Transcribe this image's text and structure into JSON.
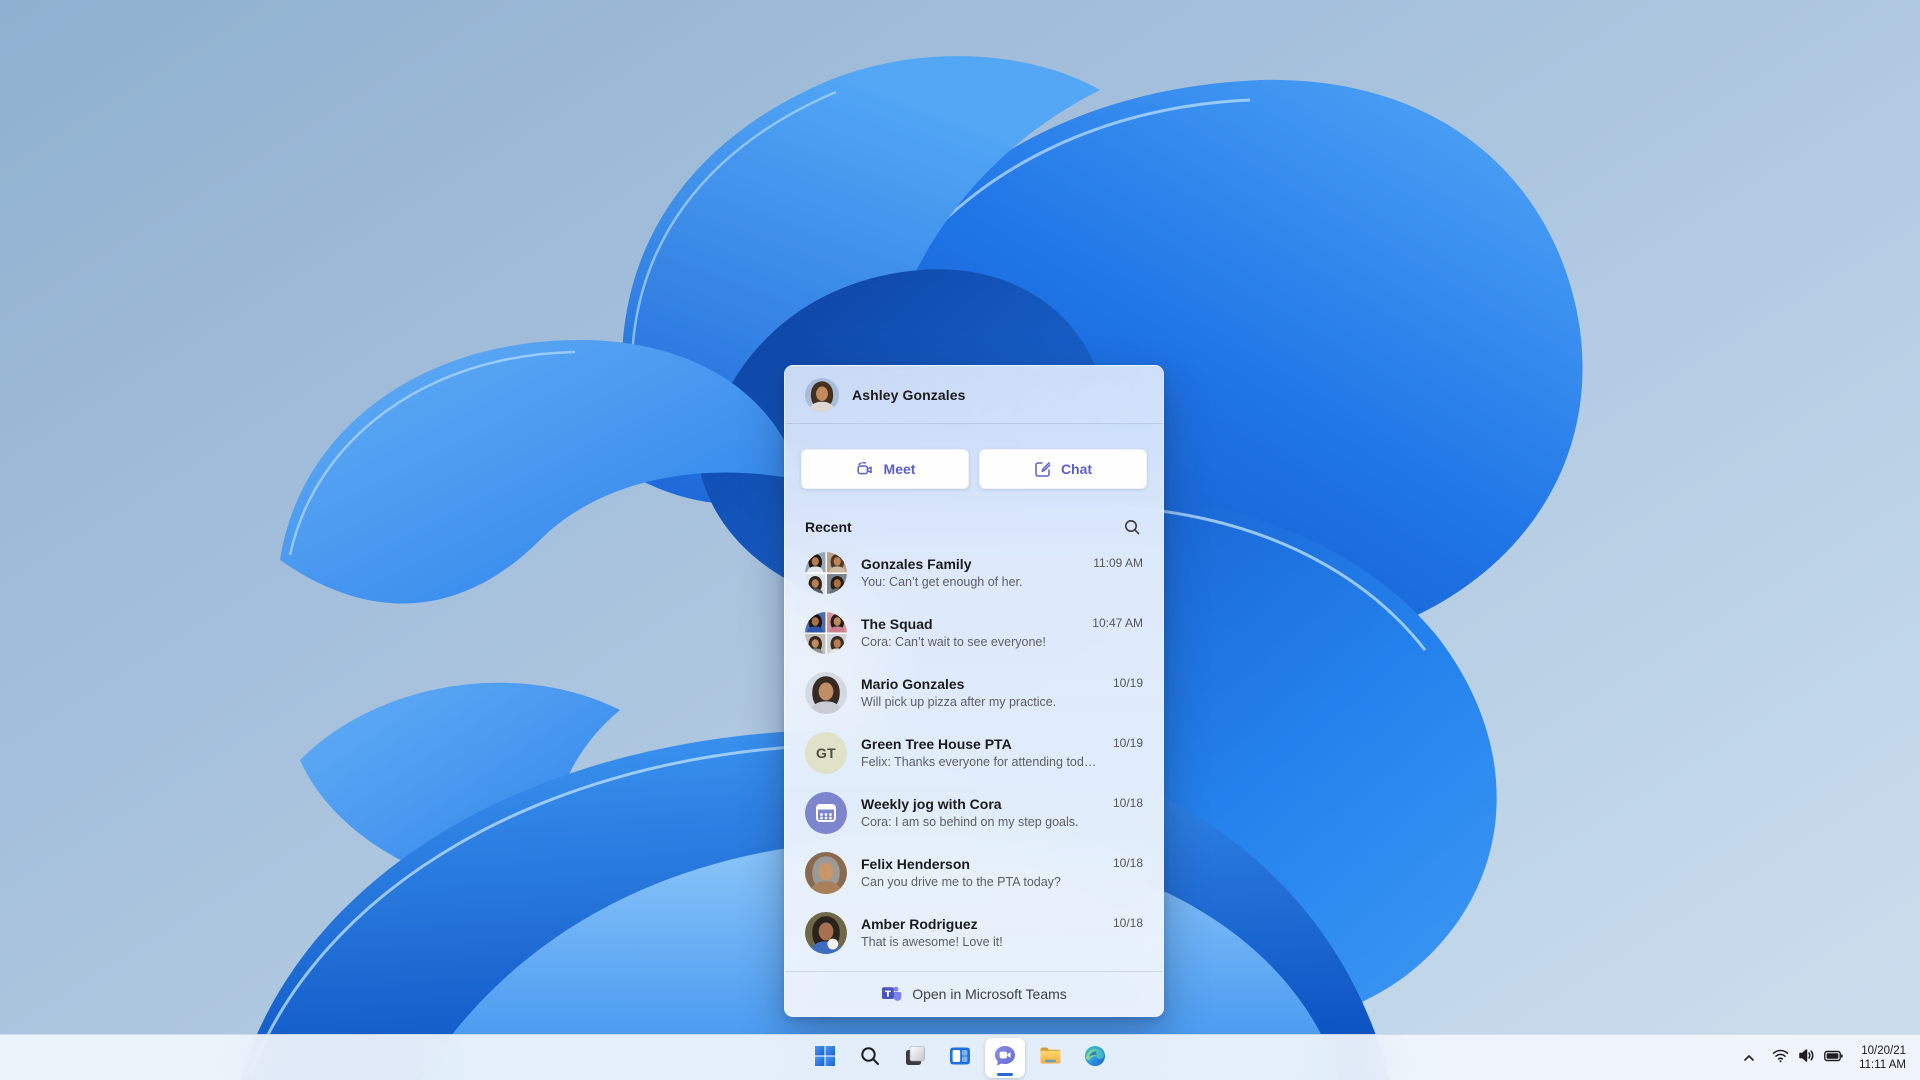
{
  "desktop": {
    "wallpaper_name": "windows-11-bloom-blue"
  },
  "chat_flyout": {
    "header": {
      "user_name": "Ashley Gonzales",
      "avatar": "ashley-photo-avatar"
    },
    "actions": [
      {
        "id": "meet",
        "label": "Meet",
        "icon": "video-camera-icon"
      },
      {
        "id": "chat",
        "label": "Chat",
        "icon": "compose-icon"
      }
    ],
    "recent": {
      "title": "Recent",
      "search_icon": "search-icon",
      "items": [
        {
          "name": "Gonzales Family",
          "preview": "You: Can’t get enough of her.",
          "time": "11:09 AM",
          "avatar_type": "group",
          "avatar_style": "family"
        },
        {
          "name": "The Squad",
          "preview": "Cora: Can’t wait to see everyone!",
          "time": "10:47 AM",
          "avatar_type": "group",
          "avatar_style": "squad"
        },
        {
          "name": "Mario Gonzales",
          "preview": "Will pick up pizza after my practice.",
          "time": "10/19",
          "avatar_type": "photo",
          "avatar_style": "mario"
        },
        {
          "name": "Green Tree House PTA",
          "preview": "Felix: Thanks everyone for attending today.",
          "time": "10/19",
          "avatar_type": "initials",
          "avatar_style": "initials",
          "initials": "GT"
        },
        {
          "name": "Weekly jog with Cora",
          "preview": "Cora: I am so behind on my step goals.",
          "time": "10/18",
          "avatar_type": "calendar",
          "avatar_style": "calendar"
        },
        {
          "name": "Felix Henderson",
          "preview": "Can you drive me to the PTA today?",
          "time": "10/18",
          "avatar_type": "photo",
          "avatar_style": "felix"
        },
        {
          "name": "Amber Rodriguez",
          "preview": "That is awesome! Love it!",
          "time": "10/18",
          "avatar_type": "photo",
          "avatar_style": "amber",
          "prop": true
        }
      ]
    },
    "footer": {
      "label": "Open in Microsoft Teams",
      "icon": "teams-logo-icon"
    }
  },
  "taskbar": {
    "buttons": [
      {
        "name": "start",
        "icon": "windows-logo-icon"
      },
      {
        "name": "search",
        "icon": "search-icon"
      },
      {
        "name": "task-view",
        "icon": "task-view-icon"
      },
      {
        "name": "widgets",
        "icon": "widgets-icon"
      },
      {
        "name": "teams-chat",
        "icon": "teams-chat-icon",
        "active": true
      },
      {
        "name": "file-explorer",
        "icon": "folder-icon"
      },
      {
        "name": "edge",
        "icon": "edge-icon"
      }
    ],
    "tray": {
      "icons": [
        "chevron-up-icon",
        "wifi-icon",
        "volume-icon",
        "battery-icon"
      ],
      "date": "10/20/21",
      "time": "11:11 AM"
    }
  },
  "colors": {
    "teams_purple": "#5b5fc7",
    "accent_blue": "#2a6bd0",
    "panel_bg": "#eef3fb",
    "taskbar_bg": "#f2f6fc",
    "wallpaper_deep_blue": "#0c46af",
    "wallpaper_bright_blue": "#2b86f0",
    "wallpaper_light_blue": "#7fc0f8",
    "wallpaper_sky": "#a9c3de"
  }
}
